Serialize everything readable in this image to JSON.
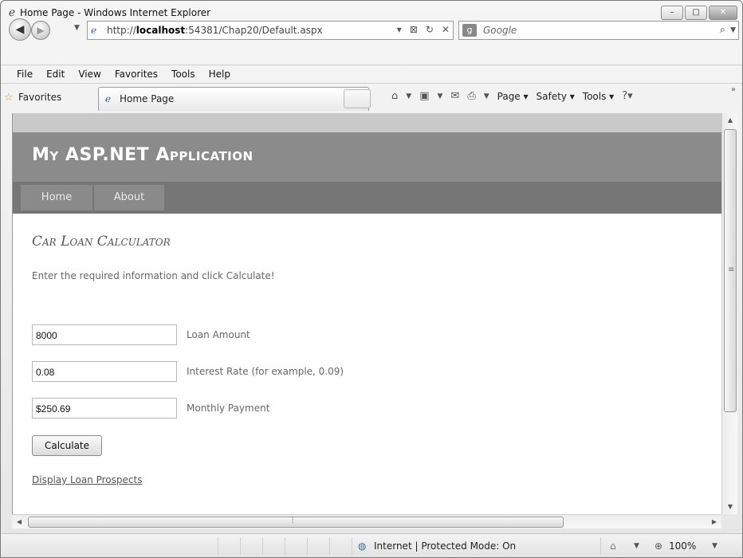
{
  "window": {
    "title": "Home Page - Windows Internet Explorer",
    "controls": {
      "minimize": "–",
      "maximize": "□",
      "close": "✕"
    }
  },
  "address_bar": {
    "url_prefix": "http://",
    "url_host": "localhost",
    "url_rest": ":54381/Chap20/Default.aspx"
  },
  "search": {
    "placeholder": "Google"
  },
  "menu": [
    "File",
    "Edit",
    "View",
    "Favorites",
    "Tools",
    "Help"
  ],
  "favorites_bar": {
    "favorites_label": "Favorites",
    "tab_label": "Home Page",
    "commands": {
      "page": "Page",
      "safety": "Safety",
      "tools": "Tools"
    }
  },
  "page": {
    "app_title": "My ASP.NET Application",
    "nav": [
      "Home",
      "About"
    ],
    "heading": "Car Loan Calculator",
    "intro": "Enter the required information and click Calculate!",
    "fields": [
      {
        "value": "8000",
        "label": "Loan Amount"
      },
      {
        "value": "0.08",
        "label": "Interest Rate (for example, 0.09)"
      },
      {
        "value": "$250.69",
        "label": "Monthly Payment"
      }
    ],
    "button": "Calculate",
    "link": "Display Loan Prospects"
  },
  "status_bar": {
    "zone": "Internet | Protected Mode: On",
    "zoom": "100%"
  }
}
